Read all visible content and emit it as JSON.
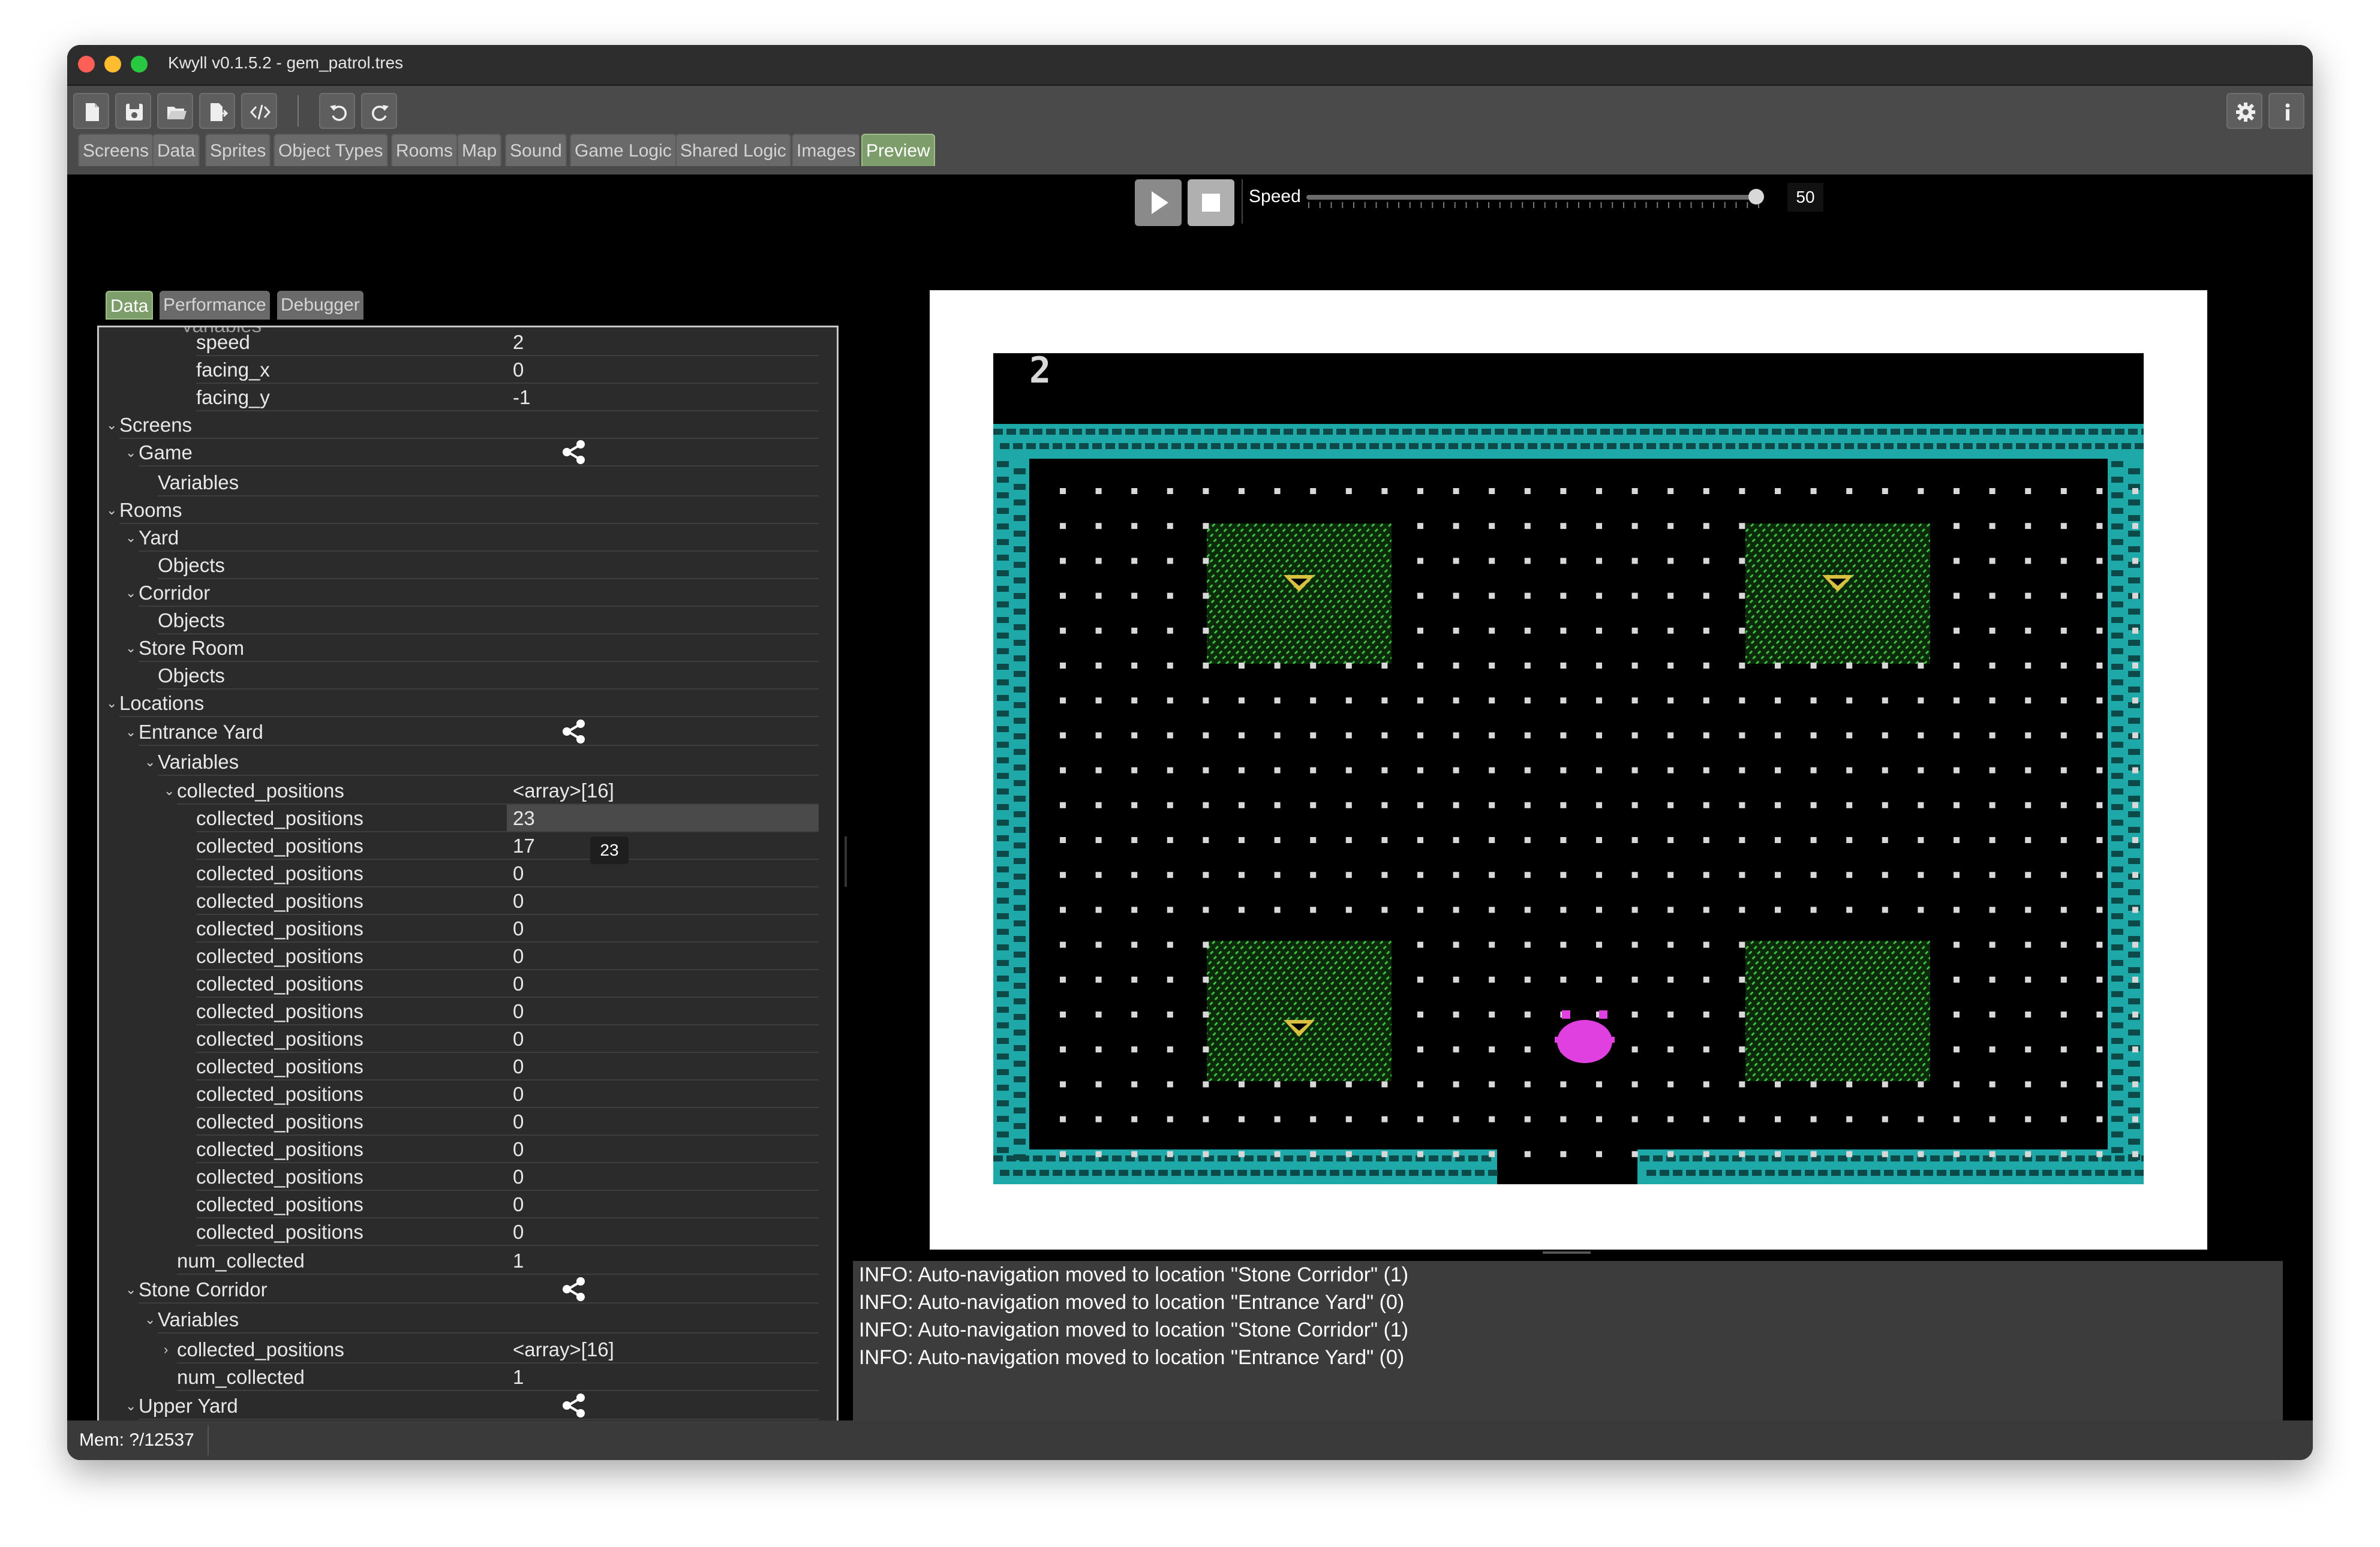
{
  "window": {
    "title": "Kwyll v0.1.5.2 - gem_patrol.tres",
    "traffic_lights": {
      "close": "#ff5f57",
      "minimize": "#febc2e",
      "zoom": "#28c840"
    }
  },
  "toolbar": {
    "buttons": [
      "new-file-icon",
      "save-icon",
      "open-folder-icon",
      "export-icon",
      "code-icon",
      "undo-icon",
      "redo-icon"
    ],
    "right_buttons": [
      "gear-icon",
      "info-icon"
    ]
  },
  "tabs": [
    {
      "label": "Screens"
    },
    {
      "label": "Data"
    },
    {
      "label": "Sprites"
    },
    {
      "label": "Object Types"
    },
    {
      "label": "Rooms"
    },
    {
      "label": "Map"
    },
    {
      "label": "Sound"
    },
    {
      "label": "Game Logic"
    },
    {
      "label": "Shared Logic"
    },
    {
      "label": "Images"
    },
    {
      "label": "Preview"
    }
  ],
  "active_tab": "Preview",
  "playbar": {
    "speed_label": "Speed",
    "speed_value": "50",
    "speed_level": 0.99
  },
  "subtabs": [
    {
      "label": "Data"
    },
    {
      "label": "Performance"
    },
    {
      "label": "Debugger"
    }
  ],
  "tree": {
    "partial_top": "Variables",
    "rows": [
      {
        "label": "speed",
        "value": "2"
      },
      {
        "label": "facing_x",
        "value": "0"
      },
      {
        "label": "facing_y",
        "value": "-1"
      },
      {
        "label": "Screens",
        "value": ""
      },
      {
        "label": "Game",
        "value": ""
      },
      {
        "label": "Variables",
        "value": ""
      },
      {
        "label": "Rooms",
        "value": ""
      },
      {
        "label": "Yard",
        "value": ""
      },
      {
        "label": "Objects",
        "value": ""
      },
      {
        "label": "Corridor",
        "value": ""
      },
      {
        "label": "Objects",
        "value": ""
      },
      {
        "label": "Store Room",
        "value": ""
      },
      {
        "label": "Objects",
        "value": ""
      },
      {
        "label": "Locations",
        "value": ""
      },
      {
        "label": "Entrance Yard",
        "value": ""
      },
      {
        "label": "Variables",
        "value": ""
      },
      {
        "label": "collected_positions",
        "value": "<array>[16]"
      },
      {
        "label": "collected_positions",
        "value": "23"
      },
      {
        "label": "collected_positions",
        "value": "17"
      },
      {
        "label": "collected_positions",
        "value": "0"
      },
      {
        "label": "collected_positions",
        "value": "0"
      },
      {
        "label": "collected_positions",
        "value": "0"
      },
      {
        "label": "collected_positions",
        "value": "0"
      },
      {
        "label": "collected_positions",
        "value": "0"
      },
      {
        "label": "collected_positions",
        "value": "0"
      },
      {
        "label": "collected_positions",
        "value": "0"
      },
      {
        "label": "collected_positions",
        "value": "0"
      },
      {
        "label": "collected_positions",
        "value": "0"
      },
      {
        "label": "collected_positions",
        "value": "0"
      },
      {
        "label": "collected_positions",
        "value": "0"
      },
      {
        "label": "collected_positions",
        "value": "0"
      },
      {
        "label": "collected_positions",
        "value": "0"
      },
      {
        "label": "collected_positions",
        "value": "0"
      },
      {
        "label": "num_collected",
        "value": "1"
      },
      {
        "label": "Stone Corridor",
        "value": ""
      },
      {
        "label": "Variables",
        "value": ""
      },
      {
        "label": "collected_positions",
        "value": "<array>[16]"
      },
      {
        "label": "num_collected",
        "value": "1"
      },
      {
        "label": "Upper Yard",
        "value": ""
      }
    ],
    "tooltip": "23"
  },
  "game": {
    "score": "2",
    "colors": {
      "wall": "#1fa8a8",
      "grass": "#3fbf3f",
      "gem": "#d8c040",
      "player": "#e040e0",
      "dot": "#d8d8d8"
    }
  },
  "log": [
    "INFO: Auto-navigation moved to location \"Stone Corridor\" (1)",
    "INFO: Auto-navigation moved to location \"Entrance Yard\" (0)",
    "INFO: Auto-navigation moved to location \"Stone Corridor\" (1)",
    "INFO: Auto-navigation moved to location \"Entrance Yard\" (0)"
  ],
  "status": {
    "mem": "Mem: ?/12537"
  }
}
